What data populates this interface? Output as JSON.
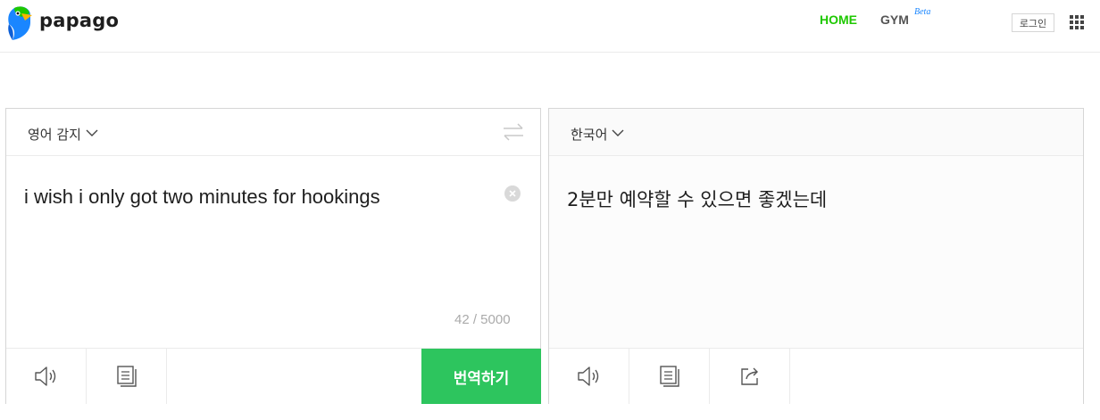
{
  "header": {
    "logo_text": "papago",
    "nav_home": "HOME",
    "nav_gym": "GYM",
    "nav_beta": "Beta",
    "login": "로그인",
    "apps_icon": "grid-apps-icon"
  },
  "source": {
    "language": "영어 감지",
    "text": "i wish i only got two minutes for hookings",
    "char_count": "42 / 5000",
    "translate_button": "번역하기"
  },
  "target": {
    "language": "한국어",
    "text": "2분만 예약할 수 있으면 좋겠는데"
  },
  "colors": {
    "accent_green": "#1ec800",
    "button_green": "#2dc55e",
    "beta_blue": "#1a86ff"
  }
}
